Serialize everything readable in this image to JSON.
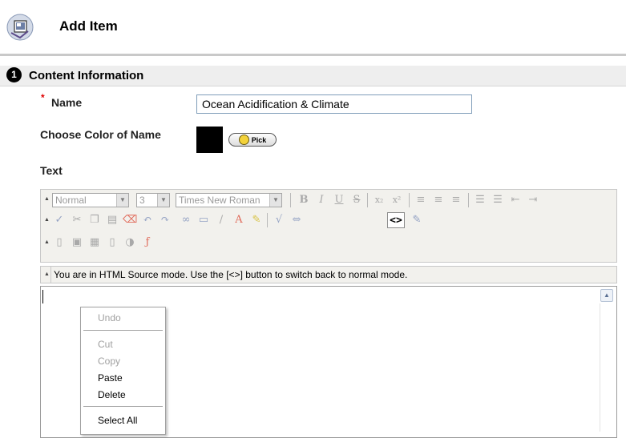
{
  "page": {
    "title": "Add Item",
    "icon": "document-add-icon"
  },
  "section": {
    "step": "1",
    "title": "Content Information"
  },
  "form": {
    "required_marker": "*",
    "name_label": "Name",
    "name_value": "Ocean Acidification & Climate",
    "color_label": "Choose Color of Name",
    "color_value": "#000000",
    "pick_label": "Pick",
    "text_label": "Text"
  },
  "toolbar": {
    "format_select": "Normal",
    "size_select": "3",
    "font_select": "Times New Roman",
    "source_button": "<>"
  },
  "status": {
    "message": "You are in HTML Source mode. Use the [<>] button to switch back to normal mode."
  },
  "context_menu": {
    "undo": "Undo",
    "cut": "Cut",
    "copy": "Copy",
    "paste": "Paste",
    "delete": "Delete",
    "select_all": "Select All"
  }
}
